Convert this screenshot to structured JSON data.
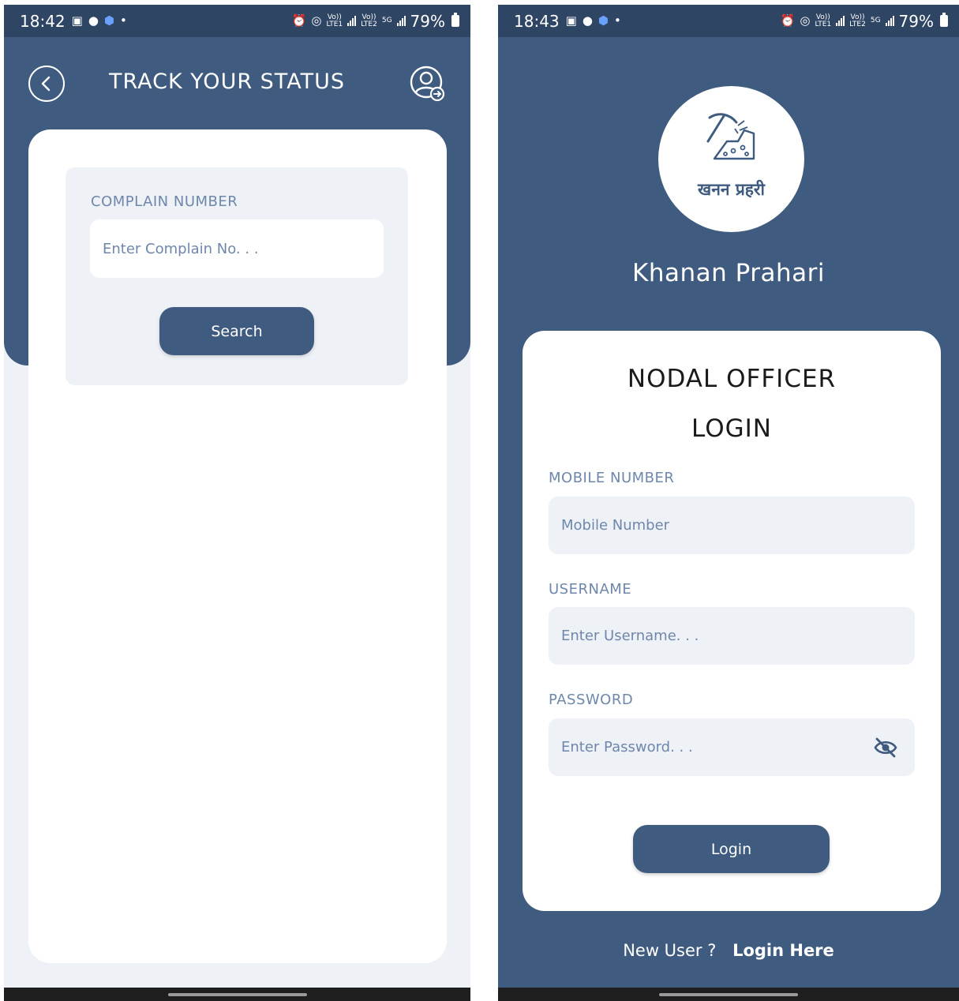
{
  "left_screen": {
    "status_bar": {
      "time": "18:42",
      "battery": "79%"
    },
    "header": {
      "title": "TRACK YOUR STATUS"
    },
    "complain": {
      "label": "COMPLAIN NUMBER",
      "placeholder": "Enter Complain No. . .",
      "search_label": "Search"
    }
  },
  "right_screen": {
    "status_bar": {
      "time": "18:43",
      "battery": "79%"
    },
    "logo": {
      "hindi_text": "खनन प्रहरी"
    },
    "app_name": "Khanan Prahari",
    "login": {
      "title": "NODAL OFFICER LOGIN",
      "mobile_label": "MOBILE NUMBER",
      "mobile_placeholder": "Mobile Number",
      "username_label": "USERNAME",
      "username_placeholder": "Enter Username. . .",
      "password_label": "PASSWORD",
      "password_placeholder": "Enter Password. . .",
      "button_label": "Login"
    },
    "signup": {
      "prompt": "New User ?",
      "link": "Login Here"
    }
  },
  "status_icons": {
    "volte_label": "Vo))",
    "lte1_label": "LTE1",
    "lte2_label": "LTE2",
    "fiveg_label": "5G"
  },
  "colors": {
    "primary": "#3f5b80",
    "status_bar": "#2f4564",
    "label": "#6e87ab",
    "field_bg": "#eef1f6"
  },
  "icons": {
    "back": "chevron-left-icon",
    "profile": "user-logout-icon",
    "logo": "mining-pickaxe-icon",
    "password_toggle": "eye-off-icon"
  }
}
